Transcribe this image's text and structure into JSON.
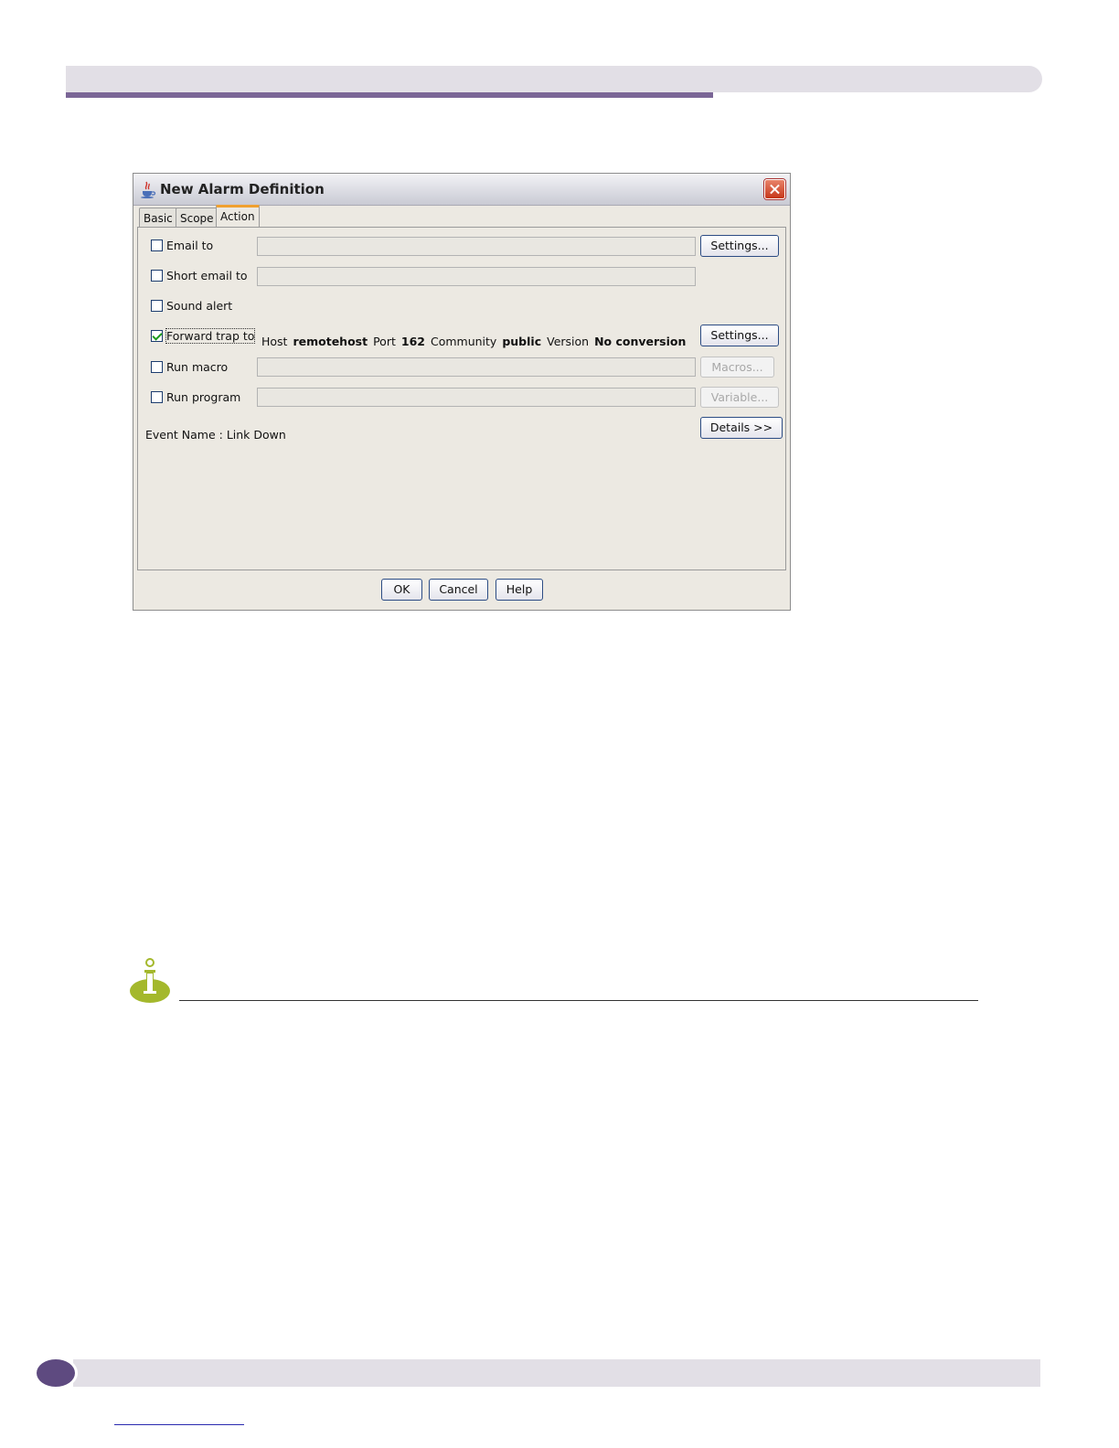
{
  "dialog": {
    "title": "New Alarm Definition",
    "tabs": [
      {
        "label": "Basic",
        "active": false
      },
      {
        "label": "Scope",
        "active": false
      },
      {
        "label": "Action",
        "active": true
      }
    ],
    "rows": {
      "email": {
        "label": "Email to",
        "checked": false,
        "value": "",
        "button": "Settings..."
      },
      "short_email": {
        "label": "Short email to",
        "checked": false,
        "value": ""
      },
      "sound": {
        "label": "Sound alert",
        "checked": false
      },
      "forward_trap": {
        "label": "Forward trap to",
        "checked": true,
        "host_label": "Host",
        "host_value": "remotehost",
        "port_label": "Port",
        "port_value": "162",
        "community_label": "Community",
        "community_value": "public",
        "version_label": "Version",
        "version_value": "No conversion",
        "button": "Settings..."
      },
      "macro": {
        "label": "Run macro",
        "checked": false,
        "value": "",
        "button": "Macros..."
      },
      "program": {
        "label": "Run program",
        "checked": false,
        "value": "",
        "button": "Variable..."
      }
    },
    "event_name": "Event Name : Link Down",
    "details_button": "Details >>",
    "footer": {
      "ok": "OK",
      "cancel": "Cancel",
      "help": "Help"
    }
  },
  "icons": {
    "title": "java-coffee-icon",
    "close": "close-icon",
    "note": "info-icon"
  },
  "colors": {
    "header_band": "#e2dfe6",
    "header_accent": "#7a6596",
    "page_badge": "#5e4a80",
    "note_icon": "#a4b82c",
    "active_tab_accent": "#f0a030"
  }
}
